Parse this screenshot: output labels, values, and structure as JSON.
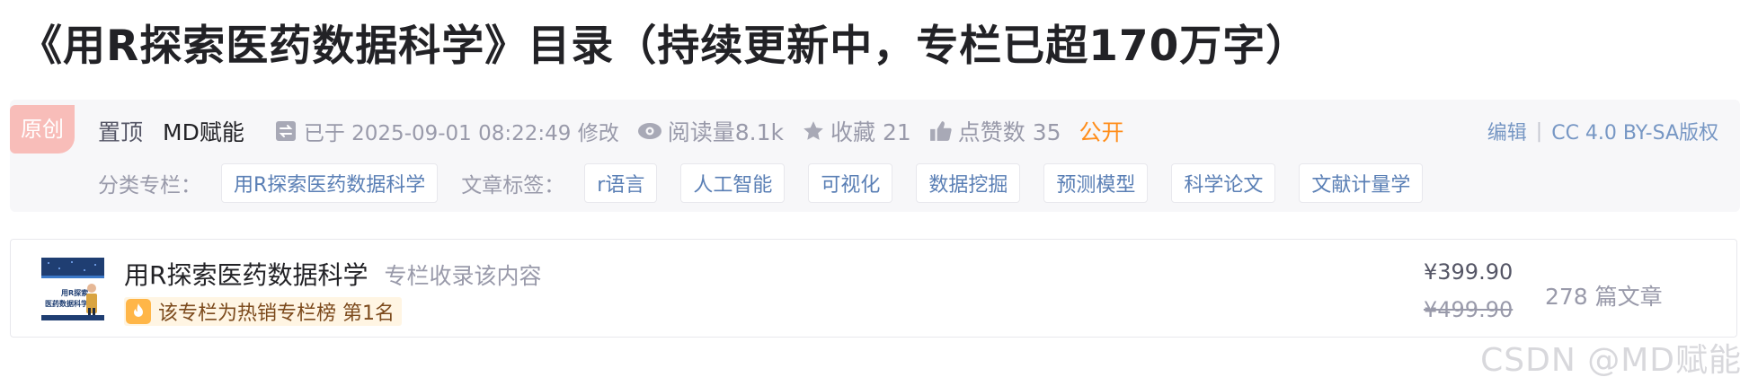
{
  "article": {
    "title": "《用R探索医药数据科学》目录（持续更新中，专栏已超170万字）"
  },
  "meta": {
    "badge": "原创",
    "pinned": "置顶",
    "author": "MD赋能",
    "modified_text": "已于 2025-09-01 08:22:49 修改",
    "reads": "阅读量8.1k",
    "favorites": "收藏 21",
    "likes": "点赞数 35",
    "visibility": "公开",
    "edit": "编辑",
    "license": "CC 4.0 BY-SA版权",
    "category_label": "分类专栏：",
    "category": "用R探索医药数据科学",
    "tags_label": "文章标签：",
    "tags": [
      "r语言",
      "人工智能",
      "可视化",
      "数据挖掘",
      "预测模型",
      "科学论文",
      "文献计量学"
    ]
  },
  "column": {
    "cover_text": "用R探索医药数据科学",
    "name": "用R探索医药数据科学",
    "subtitle": "专栏收录该内容",
    "hot_text": "该专栏为热销专栏榜 第1名",
    "price_now": "¥399.90",
    "price_old": "¥499.90",
    "articles": "278 篇文章"
  },
  "watermark": "CSDN @MD赋能",
  "colors": {
    "accent_orange": "#ff8d1a",
    "link_blue": "#5a7fb5",
    "badge_pink": "#f8bdb9"
  },
  "icons": [
    "modify-icon",
    "eye-icon",
    "star-icon",
    "thumbs-up-icon",
    "fire-icon"
  ]
}
